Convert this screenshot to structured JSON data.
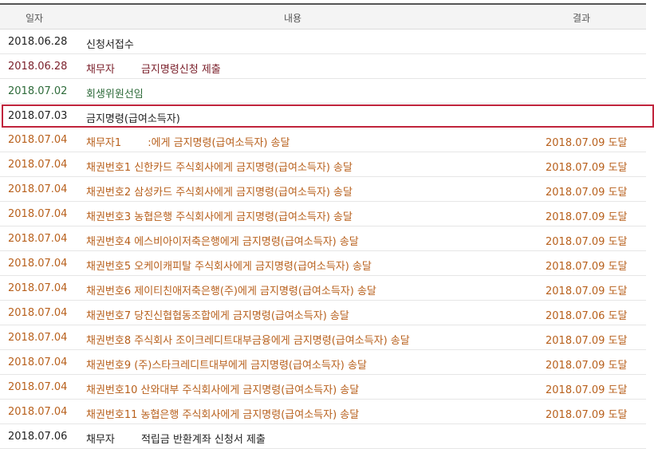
{
  "colors": {
    "dark": "#222222",
    "maroon": "#7a1f2a",
    "green": "#2e6b3a",
    "orange": "#b8601c",
    "highlight_border": "#c0243c"
  },
  "header": {
    "date": "일자",
    "content": "내용",
    "result": "결과"
  },
  "rows": [
    {
      "date": "2018.06.28",
      "content": "신청서접수",
      "result": "",
      "color": "dark",
      "highlight": false
    },
    {
      "date": "2018.06.28",
      "content": "채무자        금지명령신청 제출",
      "result": "",
      "color": "maroon",
      "highlight": false
    },
    {
      "date": "2018.07.02",
      "content": "회생위원선임",
      "result": "",
      "color": "green",
      "highlight": false
    },
    {
      "date": "2018.07.03",
      "content": "금지명령(급여소득자)",
      "result": "",
      "color": "dark",
      "highlight": true
    },
    {
      "date": "2018.07.04",
      "content": "채무자1        :에게 금지명령(급여소득자) 송달",
      "result": "2018.07.09 도달",
      "color": "orange",
      "highlight": false
    },
    {
      "date": "2018.07.04",
      "content": "채권번호1 신한카드 주식회사에게 금지명령(급여소득자) 송달",
      "result": "2018.07.09 도달",
      "color": "orange",
      "highlight": false
    },
    {
      "date": "2018.07.04",
      "content": "채권번호2 삼성카드 주식회사에게 금지명령(급여소득자) 송달",
      "result": "2018.07.09 도달",
      "color": "orange",
      "highlight": false
    },
    {
      "date": "2018.07.04",
      "content": "채권번호3 농협은행 주식회사에게 금지명령(급여소득자) 송달",
      "result": "2018.07.09 도달",
      "color": "orange",
      "highlight": false
    },
    {
      "date": "2018.07.04",
      "content": "채권번호4 에스비아이저축은행에게 금지명령(급여소득자) 송달",
      "result": "2018.07.09 도달",
      "color": "orange",
      "highlight": false
    },
    {
      "date": "2018.07.04",
      "content": "채권번호5 오케이캐피탈 주식회사에게 금지명령(급여소득자) 송달",
      "result": "2018.07.09 도달",
      "color": "orange",
      "highlight": false
    },
    {
      "date": "2018.07.04",
      "content": "채권번호6 제이티친애저축은행(주)에게 금지명령(급여소득자) 송달",
      "result": "2018.07.09 도달",
      "color": "orange",
      "highlight": false
    },
    {
      "date": "2018.07.04",
      "content": "채권번호7 당진신협협동조합에게 금지명령(급여소득자) 송달",
      "result": "2018.07.06 도달",
      "color": "orange",
      "highlight": false
    },
    {
      "date": "2018.07.04",
      "content": "채권번호8 주식회사 조이크레디트대부금융에게 금지명령(급여소득자) 송달",
      "result": "2018.07.09 도달",
      "color": "orange",
      "highlight": false
    },
    {
      "date": "2018.07.04",
      "content": "채권번호9 (주)스타크레디트대부에게 금지명령(급여소득자) 송달",
      "result": "2018.07.09 도달",
      "color": "orange",
      "highlight": false
    },
    {
      "date": "2018.07.04",
      "content": "채권번호10 산와대부 주식회사에게 금지명령(급여소득자) 송달",
      "result": "2018.07.09 도달",
      "color": "orange",
      "highlight": false
    },
    {
      "date": "2018.07.04",
      "content": "채권번호11 농협은행 주식회사에게 금지명령(급여소득자) 송달",
      "result": "2018.07.09 도달",
      "color": "orange",
      "highlight": false
    },
    {
      "date": "2018.07.06",
      "content": "채무자        적립금 반환계좌 신청서 제출",
      "result": "",
      "color": "dark",
      "highlight": false
    }
  ]
}
